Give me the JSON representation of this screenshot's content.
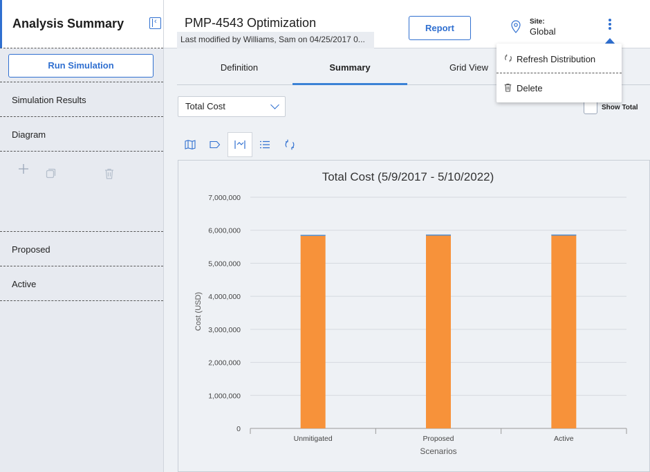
{
  "sidebar": {
    "title": "Analysis Summary",
    "run_button": "Run Simulation",
    "items": [
      {
        "label": "Simulation Results"
      },
      {
        "label": "Diagram"
      }
    ],
    "scenarios": [
      {
        "label": "Proposed"
      },
      {
        "label": "Active"
      }
    ],
    "tool_icons": [
      "plus-icon",
      "copy-icon",
      "trash-icon"
    ]
  },
  "header": {
    "title": "PMP-4543 Optimization",
    "modified": "Last modified by Williams, Sam on 04/25/2017 0...",
    "report_button": "Report",
    "site_label": "Site:",
    "site_value": "Global"
  },
  "tabs": [
    {
      "label": "Definition"
    },
    {
      "label": "Summary",
      "active": true
    },
    {
      "label": "Grid View"
    }
  ],
  "controls": {
    "dropdown_value": "Total Cost",
    "show_total_label": "Show Total",
    "show_total_checked": false
  },
  "menu": {
    "items": [
      {
        "label": "Refresh Distribution",
        "icon": "refresh-icon"
      },
      {
        "label": "Delete",
        "icon": "trash-icon"
      }
    ]
  },
  "colors": {
    "accent": "#2f6fd0",
    "bar_fill": "#f7923a",
    "bar_top": "#4a90d9"
  },
  "chart_data": {
    "type": "bar",
    "title": "Total Cost (5/9/2017 - 5/10/2022)",
    "xlabel": "Scenarios",
    "ylabel": "Cost (USD)",
    "categories": [
      "Unmitigated",
      "Proposed",
      "Active"
    ],
    "series": [
      {
        "values": [
          5860000,
          5870000,
          5870000
        ]
      }
    ],
    "ylim": [
      0,
      7000000
    ],
    "yticks": [
      0,
      1000000,
      2000000,
      3000000,
      4000000,
      5000000,
      6000000,
      7000000
    ],
    "ytick_labels": [
      "0",
      "1,000,000",
      "2,000,000",
      "3,000,000",
      "4,000,000",
      "5,000,000",
      "6,000,000",
      "7,000,000"
    ],
    "grid": true,
    "legend": "none"
  }
}
